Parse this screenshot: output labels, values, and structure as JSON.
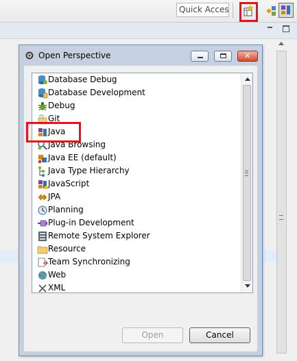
{
  "toolbar": {
    "quick_access_placeholder": "Quick Access"
  },
  "dialog": {
    "title": "Open Perspective",
    "close_glyph": "✕",
    "items": [
      {
        "label": "Database Debug",
        "icon": "database-debug-icon"
      },
      {
        "label": "Database Development",
        "icon": "database-development-icon"
      },
      {
        "label": "Debug",
        "icon": "debug-bug-icon"
      },
      {
        "label": "Git",
        "icon": "git-icon"
      },
      {
        "label": "Java",
        "icon": "java-perspective-icon"
      },
      {
        "label": "Java Browsing",
        "icon": "java-browsing-icon"
      },
      {
        "label": "Java EE (default)",
        "icon": "java-ee-icon"
      },
      {
        "label": "Java Type Hierarchy",
        "icon": "type-hierarchy-icon"
      },
      {
        "label": "JavaScript",
        "icon": "javascript-icon"
      },
      {
        "label": "JPA",
        "icon": "jpa-icon"
      },
      {
        "label": "Planning",
        "icon": "planning-clock-icon"
      },
      {
        "label": "Plug-in Development",
        "icon": "plugin-development-icon"
      },
      {
        "label": "Remote System Explorer",
        "icon": "remote-system-explorer-icon"
      },
      {
        "label": "Resource",
        "icon": "resource-folder-icon"
      },
      {
        "label": "Team Synchronizing",
        "icon": "team-synchronizing-icon"
      },
      {
        "label": "Web",
        "icon": "web-globe-icon"
      },
      {
        "label": "XML",
        "icon": "xml-icon"
      }
    ],
    "buttons": {
      "open": "Open",
      "cancel": "Cancel"
    }
  },
  "colors": {
    "highlight_box": "#e8141c",
    "dialog_frame": "#c5d1e1"
  }
}
